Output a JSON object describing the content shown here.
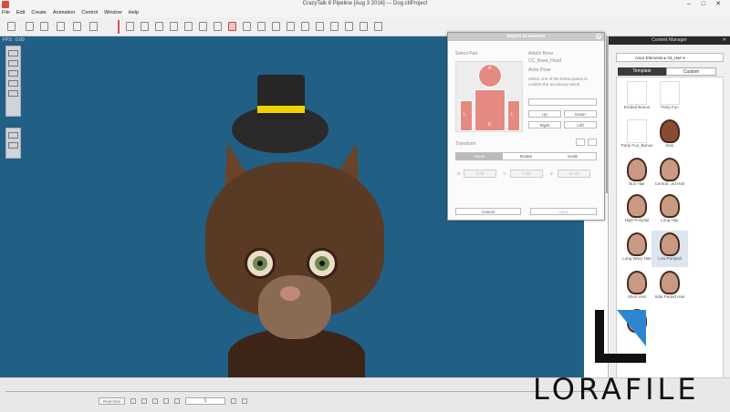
{
  "window": {
    "title": "CrazyTalk 8 Pipeline [Aug  3 2016] --- Dog.ctlProject"
  },
  "menu": [
    "File",
    "Edit",
    "Create",
    "Animation",
    "Control",
    "Window",
    "Help"
  ],
  "viewport": {
    "fps": "FPS : 0.00"
  },
  "dialog": {
    "title": "Import Accessory",
    "select_part": "Select Part",
    "attach_bone": "Attach Bone",
    "bone_name": "CC_Base_Head",
    "actor_pose": "Actor Pose",
    "pose_hint": "Select one of the below poses to confirm the accessory result",
    "up": "Up",
    "down": "Down",
    "right": "Right",
    "left": "Left",
    "transform": "Transform",
    "modes": [
      "Move",
      "Rotate",
      "Scale"
    ],
    "axis_x": "X:",
    "axis_y": "Y:",
    "axis_z": "Z:",
    "x_val": "0.00",
    "y_val": "7.90",
    "z_val": "10.00",
    "cancel": "Cancel",
    "apply": "Apply",
    "part_labels": [
      "A",
      "B",
      "C",
      "D",
      "E",
      "F",
      "G",
      "H",
      "I",
      "J",
      "K",
      "L",
      "L"
    ]
  },
  "content_manager": {
    "title": "Content Manager",
    "path": "Actor Elements ▸ 03_Hair ▾",
    "tabs": [
      "Template",
      "Custom"
    ],
    "items": [
      "Embed Bonus",
      "Party Fun",
      "Party Fun_Bonus",
      "Bob",
      "Bun Hair",
      "Central...ed Hair",
      "High Ponytail",
      "Long Hair",
      "Long Wavy Hair",
      "Low Ponytail",
      "Short Hair",
      "Side Parted Hair",
      ""
    ]
  },
  "timeline": {
    "record": "Real time",
    "frame": "1"
  },
  "watermark": {
    "text": "LORAFILE"
  },
  "colors": {
    "viewport_bg": "#215f85",
    "accent": "#d9534f",
    "dialog_selected": "#e48a80",
    "hat_band": "#f3d000"
  }
}
